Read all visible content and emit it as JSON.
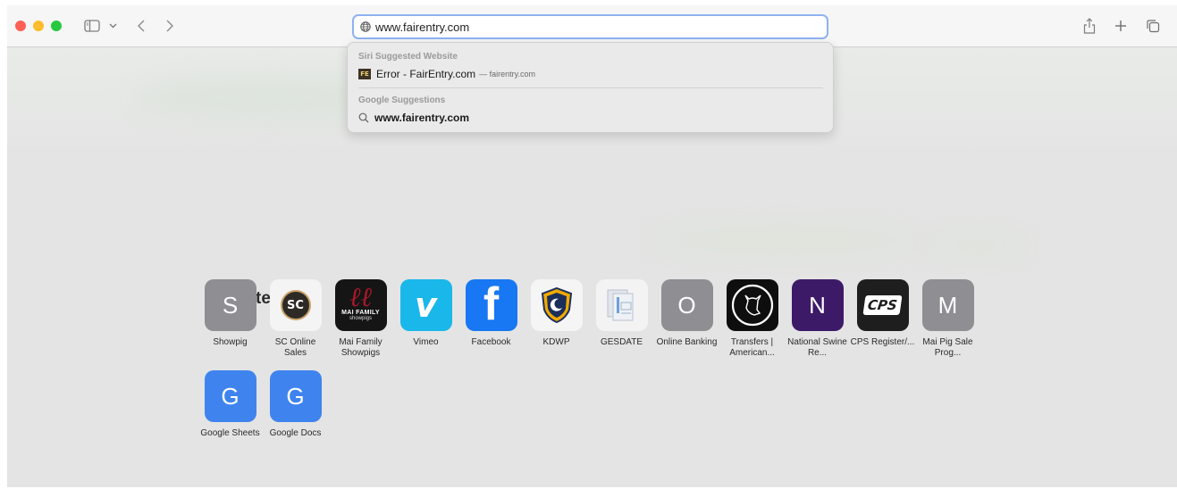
{
  "toolbar": {
    "address": "www.fairentry.com"
  },
  "dropdown": {
    "siri_header": "Siri Suggested Website",
    "siri_logo_text": "FE",
    "siri_title": "Error - FairEntry.com",
    "siri_domain": "— fairentry.com",
    "google_header": "Google Suggestions",
    "google_query": "www.fairentry.com"
  },
  "favorites": {
    "title": "Favorites",
    "items": [
      {
        "label": "Showpig",
        "letter": "S",
        "color": "#8e8e93"
      },
      {
        "label": "SC Online Sales",
        "logo_text": "SC",
        "color": "#f4f4f4"
      },
      {
        "label": "Mai Family Showpigs",
        "logo_text": "MAI FAMILY",
        "logo_subtext": "showpigs",
        "color": "#151515"
      },
      {
        "label": "Vimeo",
        "logo_text": "v",
        "color": "#1ab7ea"
      },
      {
        "label": "Facebook",
        "logo_text": "f",
        "color": "#1877f2"
      },
      {
        "label": "KDWP",
        "color": "#f5f5f5"
      },
      {
        "label": "GESDATE",
        "color": "#f3f3f3"
      },
      {
        "label": "Online Banking",
        "letter": "O",
        "color": "#8e8e93"
      },
      {
        "label": "Transfers | American...",
        "color": "#0e0e0e"
      },
      {
        "label": "National Swine Re...",
        "letter": "N",
        "color": "#3d1a68"
      },
      {
        "label": "CPS Register/...",
        "logo_text": "CPS",
        "color": "#1e1e1e"
      },
      {
        "label": "Mai Pig Sale Prog...",
        "letter": "M",
        "color": "#8e8e93"
      },
      {
        "label": "Google Sheets",
        "letter": "G",
        "color": "#3f84ee"
      },
      {
        "label": "Google Docs",
        "letter": "G",
        "color": "#3f84ee"
      }
    ]
  },
  "colors": {
    "close": "#fe5f57",
    "minimize": "#febc2e",
    "zoom": "#28c840",
    "address_focus": "#8fb2f0"
  },
  "icons": [
    "sidebar-icon",
    "chevron-down-icon",
    "back-icon",
    "forward-icon",
    "globe-icon",
    "share-icon",
    "new-tab-icon",
    "tab-overview-icon",
    "search-icon"
  ]
}
